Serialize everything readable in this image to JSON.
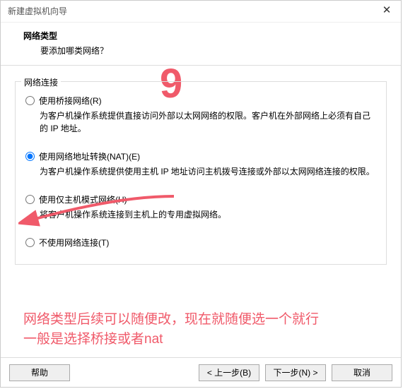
{
  "title": "新建虚拟机向导",
  "header": {
    "title": "网络类型",
    "subtitle": "要添加哪类网络？"
  },
  "fieldset_label": "网络连接",
  "options": [
    {
      "label": "使用桥接网络(R)",
      "desc": "为客户机操作系统提供直接访问外部以太网网络的权限。客户机在外部网络上必须有自己的 IP 地址。"
    },
    {
      "label": "使用网络地址转换(NAT)(E)",
      "desc": "为客户机操作系统提供使用主机 IP 地址访问主机拨号连接或外部以太网网络连接的权限。"
    },
    {
      "label": "使用仅主机模式网络(H)",
      "desc": "将客户机操作系统连接到主机上的专用虚拟网络。"
    },
    {
      "label": "不使用网络连接(T)",
      "desc": ""
    }
  ],
  "buttons": {
    "help": "帮助",
    "back": "< 上一步(B)",
    "next": "下一步(N) >",
    "cancel": "取消"
  },
  "annotation": {
    "number": "9",
    "line1": "网络类型后续可以随便改，现在就随便选一个就行",
    "line2": "一般是选择桥接或者nat"
  }
}
